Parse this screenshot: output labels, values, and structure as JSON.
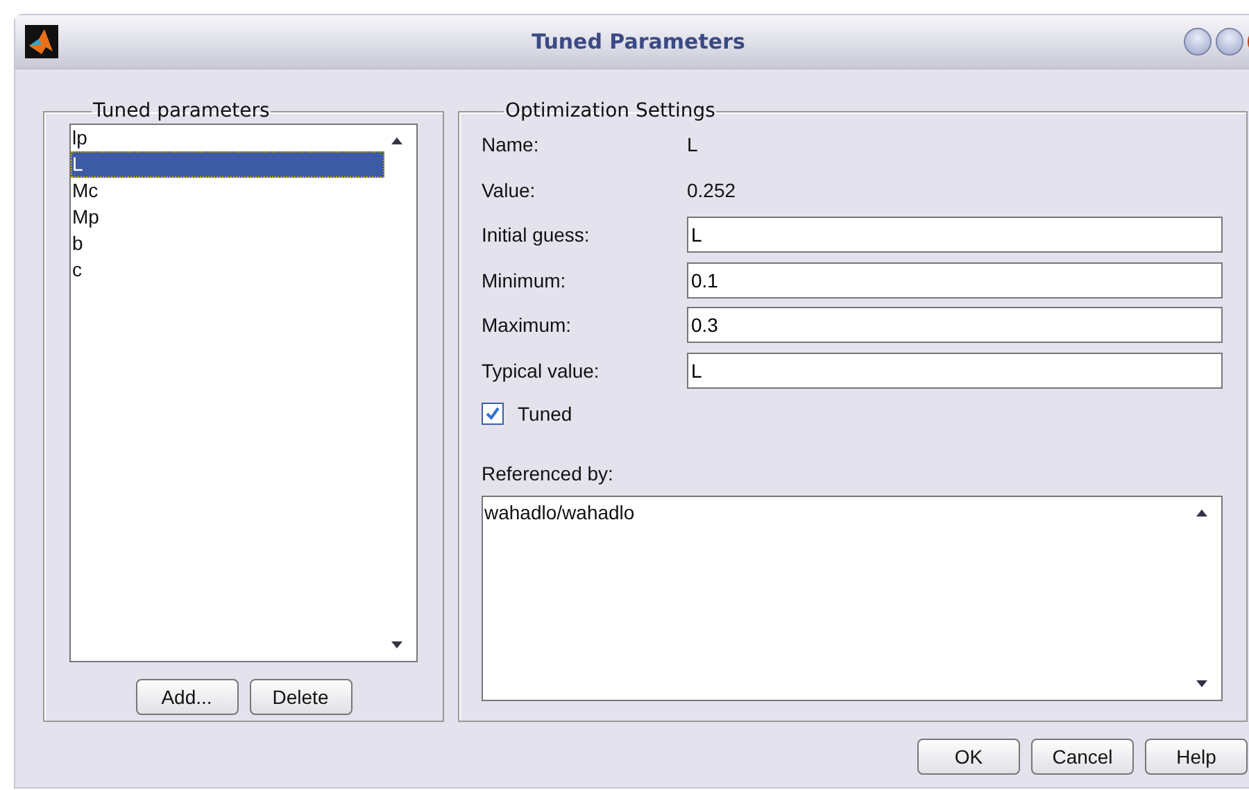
{
  "window": {
    "title": "Tuned Parameters"
  },
  "parameters_panel": {
    "title": "Tuned parameters",
    "items": [
      {
        "label": "lp",
        "selected": false
      },
      {
        "label": "L",
        "selected": true
      },
      {
        "label": "Mc",
        "selected": false
      },
      {
        "label": "Mp",
        "selected": false
      },
      {
        "label": "b",
        "selected": false
      },
      {
        "label": "c",
        "selected": false
      }
    ],
    "buttons": [
      "Add...",
      "Delete"
    ]
  },
  "settings": {
    "title": "Optimization Settings",
    "info": [
      {
        "label": "Name:",
        "value": "L"
      },
      {
        "label": "Value:",
        "value": "0.252"
      }
    ],
    "fields": [
      {
        "label": "Initial guess:",
        "value": "L"
      },
      {
        "label": "Minimum:",
        "value": "0.1"
      },
      {
        "label": "Maximum:",
        "value": "0.3"
      },
      {
        "label": "Typical value:",
        "value": "L"
      }
    ],
    "tuned": {
      "label": "Tuned",
      "checked": true
    },
    "referenced_by": {
      "label": "Referenced by:",
      "items": [
        "wahadlo/wahadlo"
      ]
    }
  },
  "buttons": [
    "OK",
    "Cancel",
    "Help"
  ]
}
